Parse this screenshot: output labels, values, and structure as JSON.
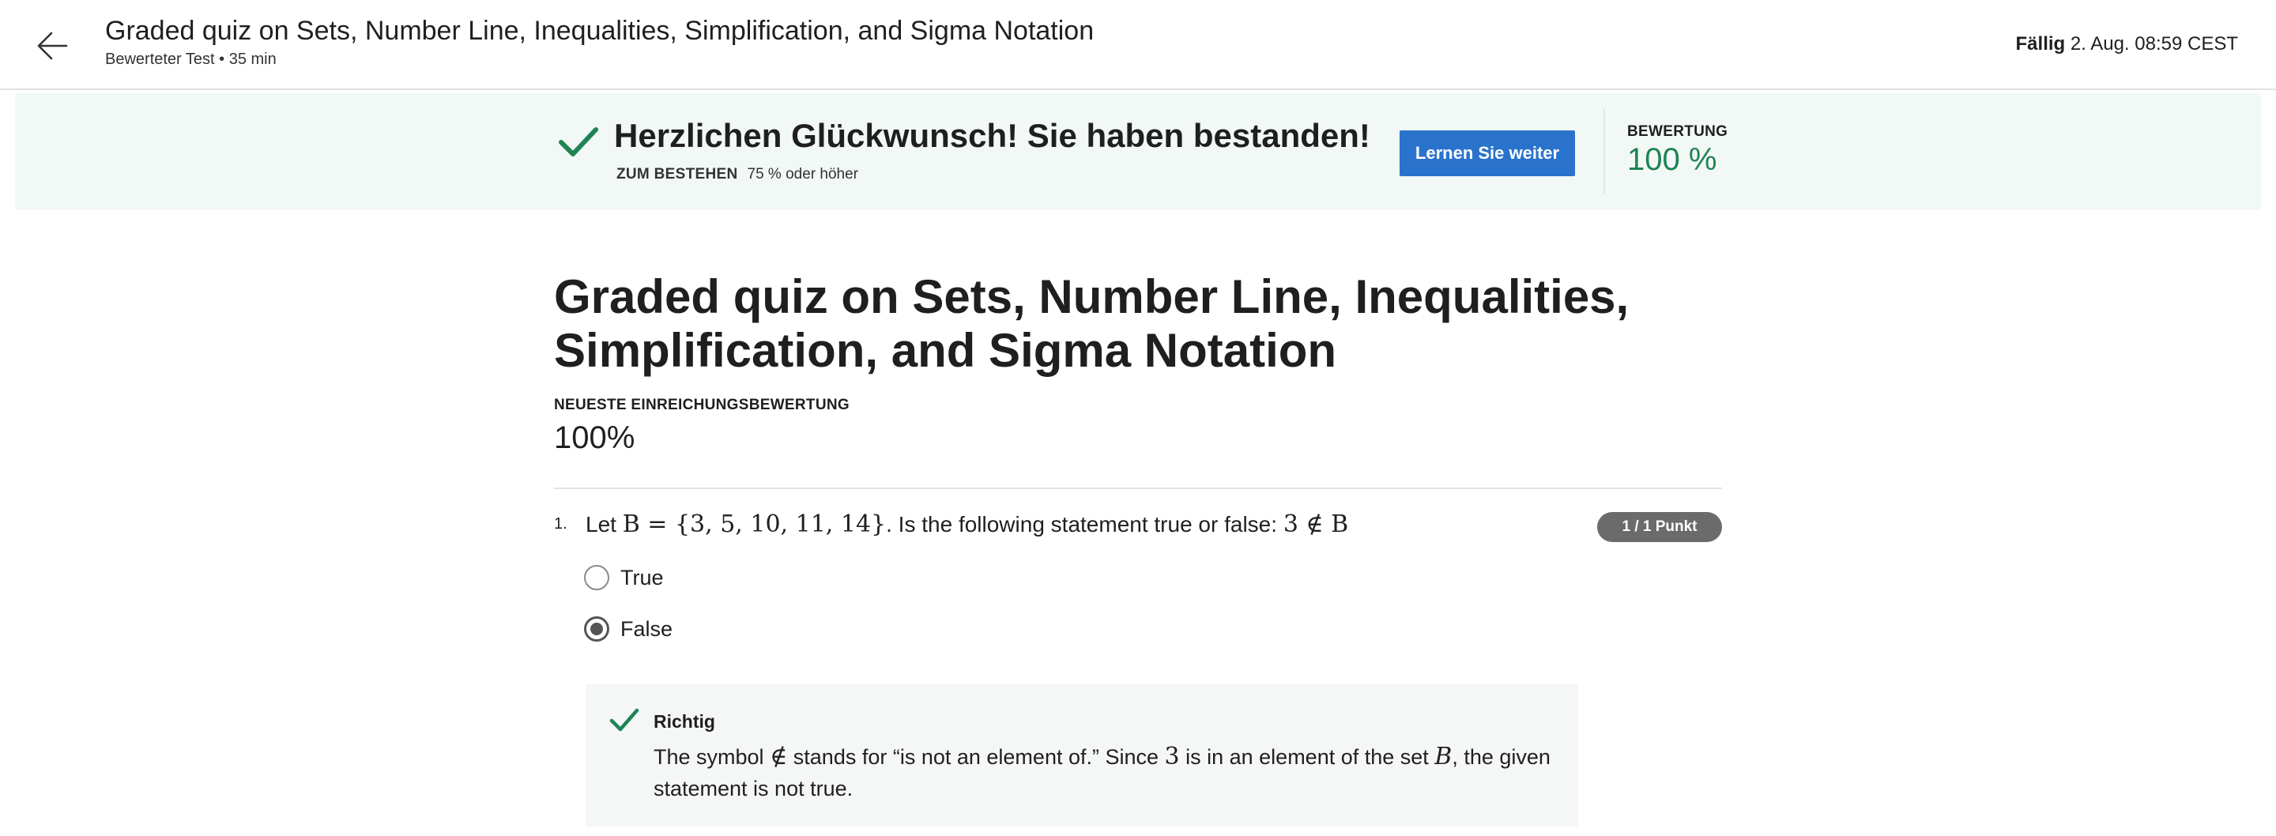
{
  "header": {
    "title": "Graded quiz on Sets, Number Line, Inequalities, Simplification, and Sigma Notation",
    "subtitle": "Bewerteter Test • 35 min",
    "due_label": "Fällig",
    "due_value": "2. Aug. 08:59 CEST",
    "back_icon": "arrow-left-icon"
  },
  "banner": {
    "message": "Herzlichen Glückwunsch! Sie haben bestanden!",
    "pass_label": "ZUM BESTEHEN",
    "pass_value": "75 % oder höher",
    "continue_label": "Lernen Sie weiter",
    "grade_label": "BEWERTUNG",
    "grade_value": "100 %",
    "check_icon": "checkmark-icon",
    "accent_color": "#1f8354",
    "button_color": "#2a73cc",
    "background_color": "#f2f8f5"
  },
  "main": {
    "title": "Graded quiz on Sets, Number Line, Inequalities, Simplification, and Sigma Notation",
    "latest_label": "NEUESTE EINREICHUNGSBEWERTUNG",
    "latest_value": "100%"
  },
  "question": {
    "number": "1.",
    "text_prefix": "Let ",
    "math_set": "B = {3, 5, 10, 11, 14}",
    "text_middle": ". Is the following statement true or false: ",
    "math_statement": "3 ∉ B",
    "points": "1 / 1 Punkt",
    "options": [
      {
        "label": "True",
        "selected": false
      },
      {
        "label": "False",
        "selected": true
      }
    ]
  },
  "feedback": {
    "title": "Richtig",
    "text_1": "The symbol ",
    "math_symbol": "∉",
    "text_2": " stands for “is not an element of.” Since ",
    "math_3": "3",
    "text_3": " is in an element of the set ",
    "math_B": "B",
    "text_4": ", the given statement is not true.",
    "check_icon": "checkmark-icon"
  }
}
